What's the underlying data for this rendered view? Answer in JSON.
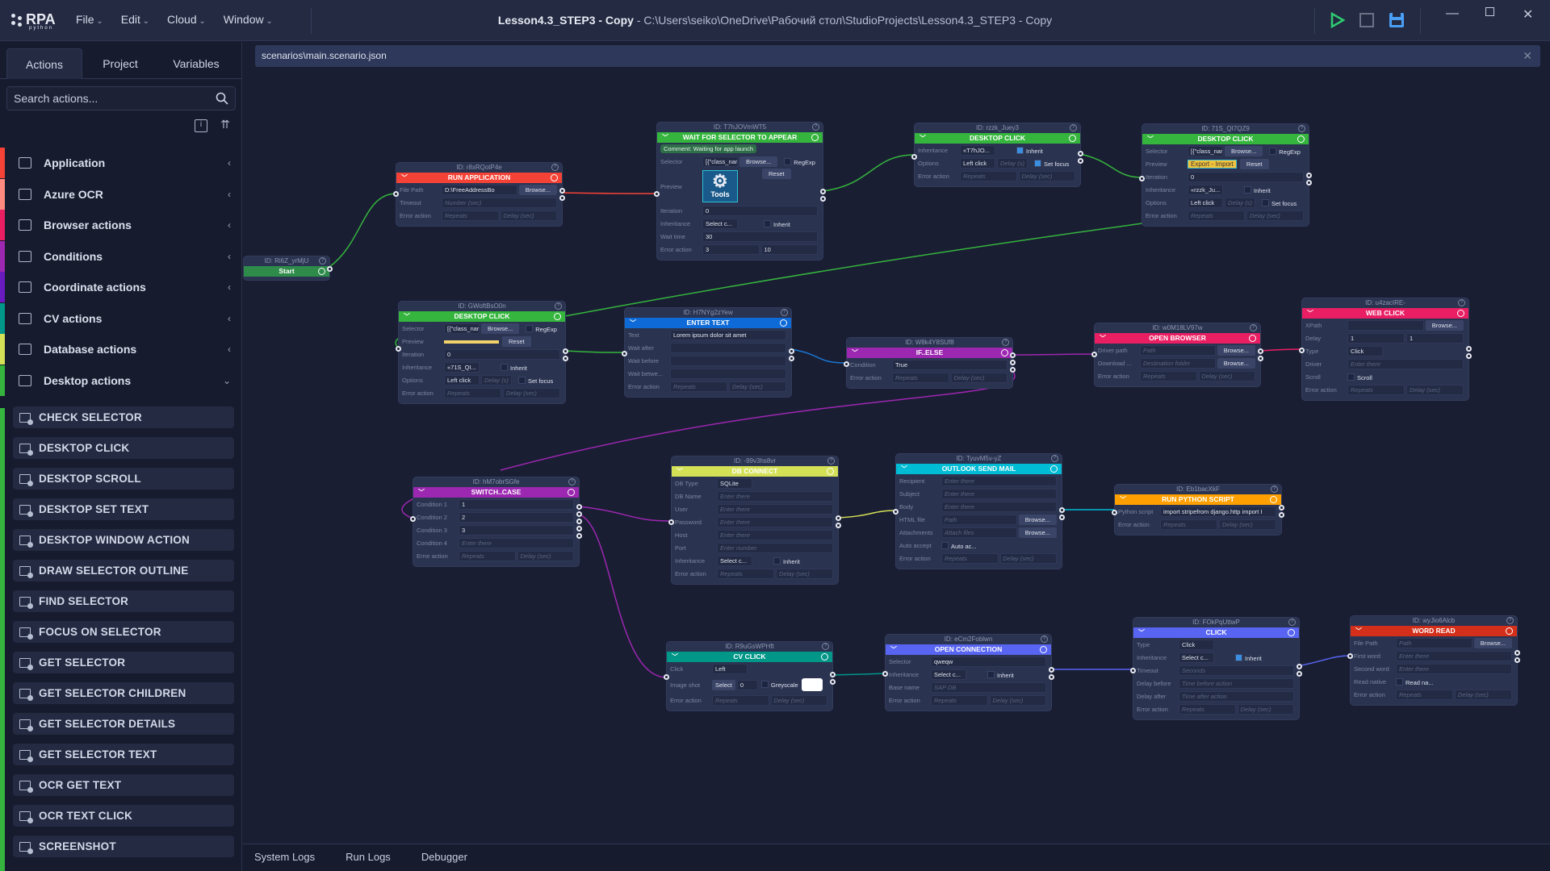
{
  "app": {
    "logo": "RPA",
    "logo_sub": "python",
    "menu": [
      "File",
      "Edit",
      "Cloud",
      "Window"
    ],
    "title_project": "Lesson4.3_STEP3 - Copy",
    "title_path": " - C:\\Users\\seiko\\OneDrive\\Рабочий стол\\StudioProjects\\Lesson4.3_STEP3 - Copy",
    "colors": {
      "run": "#2ecc71",
      "save": "#4a9ff5"
    }
  },
  "sidebar": {
    "tabs": [
      "Actions",
      "Project",
      "Variables"
    ],
    "search_placeholder": "Search actions...",
    "categories": [
      {
        "label": "Application",
        "color": "#f44336"
      },
      {
        "label": "Azure OCR",
        "color": "#ff8a80"
      },
      {
        "label": "Browser actions",
        "color": "#e91e63"
      },
      {
        "label": "Conditions",
        "color": "#9c27b0"
      },
      {
        "label": "Coordinate actions",
        "color": "#6a1bc0"
      },
      {
        "label": "CV actions",
        "color": "#009688"
      },
      {
        "label": "Database actions",
        "color": "#d4e157"
      },
      {
        "label": "Desktop actions",
        "color": "#35b53d"
      }
    ],
    "items": [
      "CHECK SELECTOR",
      "DESKTOP CLICK",
      "DESKTOP SCROLL",
      "DESKTOP SET TEXT",
      "DESKTOP WINDOW ACTION",
      "DRAW SELECTOR OUTLINE",
      "FIND SELECTOR",
      "FOCUS ON SELECTOR",
      "GET SELECTOR",
      "GET SELECTOR CHILDREN",
      "GET SELECTOR DETAILS",
      "GET SELECTOR TEXT",
      "OCR GET TEXT",
      "OCR TEXT CLICK",
      "SCREENSHOT"
    ]
  },
  "editor": {
    "file_tab": "scenarios\\main.scenario.json",
    "bottom_tabs": [
      "System Logs",
      "Run Logs",
      "Debugger"
    ]
  },
  "nodes": {
    "start": {
      "id": "ID: Ri6Z_yrMjU",
      "title": "Start"
    },
    "run_app": {
      "id": "ID: r8xRQotP4e",
      "title": "RUN APPLICATION",
      "file_path_label": "File Path",
      "file_path": "D:\\FreeAddressBo",
      "browse": "Browse...",
      "timeout_label": "Timeout",
      "timeout_ph": "Number (sec)",
      "error_label": "Error action",
      "repeats_ph": "Repeats",
      "delay_ph": "Delay (sec)"
    },
    "wait": {
      "id": "ID: T7hJOVmWT5",
      "title": "WAIT FOR SELECTOR TO APPEAR",
      "comment": "Comment: Waiting for app launch",
      "selector_label": "Selector",
      "selector": "[{\"class_nar",
      "browse": "Browse...",
      "regexp": "RegExp",
      "preview_label": "Preview",
      "preview_text": "Tools",
      "reset": "Reset",
      "iteration_label": "Iteration",
      "iteration": "0",
      "inheritance_label": "Inheritance",
      "inheritance": "Select c...",
      "inherit": "Inherit",
      "wait_label": "Wait time",
      "wait": "30",
      "error_label": "Error action",
      "repeats": "3",
      "delay": "10"
    },
    "dc1": {
      "id": "ID: rzzk_Juey3",
      "title": "DESKTOP CLICK",
      "inheritance_label": "Inheritance",
      "inheritance": "«T7hJO...",
      "inherit": "Inherit",
      "options_label": "Options",
      "options": "Left click",
      "delay_ph": "Delay (s)",
      "setfocus": "Set focus",
      "error_label": "Error action",
      "repeats_ph": "Repeats",
      "delay2_ph": "Delay (sec)"
    },
    "dc2": {
      "id": "ID: 71S_QI7QZ9",
      "title": "DESKTOP CLICK",
      "selector_label": "Selector",
      "selector": "[{\"class_nar",
      "browse": "Browse...",
      "regexp": "RegExp",
      "preview_label": "Preview",
      "preview_text": "Export - Import",
      "reset": "Reset",
      "iteration_label": "Iteration",
      "iteration": "0",
      "inheritance_label": "Inheritance",
      "inheritance": "«rzzk_Ju...",
      "inherit": "Inherit",
      "options_label": "Options",
      "options": "Left click",
      "delay_ph": "Delay (s)",
      "setfocus": "Set focus",
      "error_label": "Error action",
      "repeats_ph": "Repeats",
      "delay2_ph": "Delay (sec)"
    },
    "dc3": {
      "id": "ID: GWoftBsO0n",
      "title": "DESKTOP CLICK",
      "selector_label": "Selector",
      "selector": "[{\"class_nar",
      "browse": "Browse...",
      "regexp": "RegExp",
      "preview_label": "Preview",
      "reset": "Reset",
      "iteration_label": "Iteration",
      "iteration": "0",
      "inheritance_label": "Inheritance",
      "inheritance": "«71S_QI...",
      "inherit": "Inherit",
      "options_label": "Options",
      "options": "Left click",
      "delay_ph": "Delay (s)",
      "setfocus": "Set focus",
      "error_label": "Error action",
      "repeats_ph": "Repeats",
      "delay2_ph": "Delay (sec)"
    },
    "enter": {
      "id": "ID: H7NYg2zYew",
      "title": "ENTER TEXT",
      "text_label": "Text",
      "text": "Lorem ipsum dolor sit amet",
      "wa_label": "Wait after",
      "wb_label": "Wait before",
      "wbt_label": "Wait betwe...",
      "error_label": "Error action",
      "repeats_ph": "Repeats",
      "delay_ph": "Delay (sec)"
    },
    "ifelse": {
      "id": "ID: W8k4Y8SUf8",
      "title": "IF..ELSE",
      "cond_label": "Condition",
      "cond": "True",
      "error_label": "Error action",
      "repeats_ph": "Repeats",
      "delay_ph": "Delay (sec)"
    },
    "openbrowser": {
      "id": "ID: w0M18LV97w",
      "title": "OPEN BROWSER",
      "driver_label": "Driver path",
      "driver_ph": "Path",
      "browse": "Browse...",
      "dl_label": "Download ...",
      "dl_ph": "Destination folder",
      "error_label": "Error action",
      "repeats_ph": "Repeats",
      "delay_ph": "Delay (sec)"
    },
    "webclick": {
      "id": "ID: u4zacIRE-",
      "title": "WEB CLICK",
      "xpath_label": "XPath",
      "browse": "Browse...",
      "delay_label": "Delay",
      "delay1": "1",
      "delay2": "1",
      "type_label": "Type",
      "type": "Click",
      "driver_label": "Driver",
      "driver_ph": "Enter there",
      "scroll_label": "Scroll",
      "scroll": "Scroll",
      "error_label": "Error action",
      "repeats_ph": "Repeats",
      "delay_ph": "Delay (sec)"
    },
    "switch": {
      "id": "ID: hM7obrSGfe",
      "title": "SWITCH..CASE",
      "c1_label": "Condition 1",
      "c1": "1",
      "c2_label": "Condition 2",
      "c2": "2",
      "c3_label": "Condition 3",
      "c3": "3",
      "c4_label": "Condition 4",
      "c4_ph": "Enter there",
      "error_label": "Error action",
      "repeats_ph": "Repeats",
      "delay_ph": "Delay (sec)"
    },
    "db": {
      "id": "ID: -99v3hs8vr",
      "title": "DB CONNECT",
      "type_label": "DB Type",
      "type": "SQLite",
      "name_label": "DB Name",
      "user_label": "User",
      "pwd_label": "Password",
      "host_label": "Host",
      "port_label": "Port",
      "ph": "Enter there",
      "port_ph": "Enter number",
      "inheritance_label": "Inheritance",
      "inheritance": "Select c...",
      "inherit": "Inherit",
      "error_label": "Error action",
      "repeats_ph": "Repeats",
      "delay_ph": "Delay (sec)"
    },
    "outlook": {
      "id": "ID: TyuvM5v-yZ",
      "title": "OUTLOOK SEND MAIL",
      "rec_label": "Recipient",
      "subj_label": "Subject",
      "body_label": "Body",
      "ph": "Enter there",
      "html_label": "HTML file",
      "html_ph": "Path",
      "att_label": "Attachments",
      "att_ph": "Attach files",
      "browse": "Browse...",
      "auto_label": "Auto accept",
      "auto": "Auto ac...",
      "error_label": "Error action",
      "repeats_ph": "Repeats",
      "delay_ph": "Delay (sec)"
    },
    "python": {
      "id": "ID: Eb1bacXkF",
      "title": "RUN PYTHON SCRIPT",
      "script_label": "Python script",
      "script": "import stripefrom django.http import I",
      "error_label": "Error action",
      "repeats_ph": "Repeats",
      "delay_ph": "Delay (sec)"
    },
    "cv": {
      "id": "ID: R9uGsWPHft",
      "title": "CV CLICK",
      "click_label": "Click",
      "click": "Left",
      "shot_label": "Image shot",
      "select": "Select",
      "shot_val": "0",
      "grey": "Greyscale",
      "error_label": "Error action",
      "repeats_ph": "Repeats",
      "delay_ph": "Delay (sec)"
    },
    "openconn": {
      "id": "ID: eCm2Foblwn",
      "title": "OPEN CONNECTION",
      "sel_label": "Selector",
      "sel": "qweqw",
      "inheritance_label": "Inheritance",
      "inheritance": "Select c...",
      "inherit": "Inherit",
      "base_label": "Base name",
      "base_ph": "SAP DB",
      "error_label": "Error action",
      "repeats_ph": "Repeats",
      "delay_ph": "Delay (sec)"
    },
    "click": {
      "id": "ID: FOkPqUttwP",
      "title": "CLICK",
      "type_label": "Type",
      "type": "Click",
      "inheritance_label": "Inheritance",
      "inheritance": "Select c...",
      "inherit": "Inherit",
      "timeout_label": "Timeout",
      "timeout_ph": "Seconds",
      "db_label": "Delay before",
      "db_ph": "Time before action",
      "da_label": "Delay after",
      "da_ph": "Time after action",
      "error_label": "Error action",
      "repeats_ph": "Repeats",
      "delay_ph": "Delay (sec)"
    },
    "word": {
      "id": "ID: wyJio6Alcb",
      "title": "WORD READ",
      "fp_label": "File Path",
      "fp_ph": "Path",
      "browse": "Browse...",
      "fw_label": "First word",
      "sw_label": "Second word",
      "ph": "Enter there",
      "rn_label": "Read native",
      "rn": "Read na...",
      "error_label": "Error action",
      "repeats_ph": "Repeats",
      "delay_ph": "Delay (sec)"
    }
  }
}
